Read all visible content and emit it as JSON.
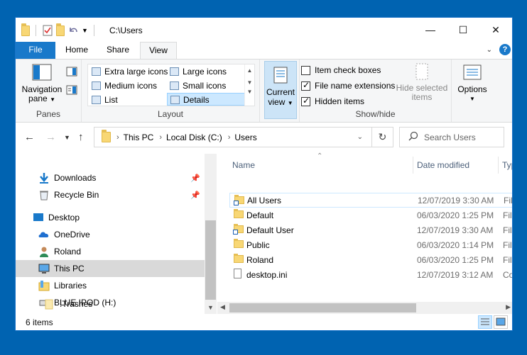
{
  "window": {
    "title": "C:\\Users"
  },
  "titlebar": {
    "minimize_glyph": "—",
    "maximize_glyph": "☐",
    "close_glyph": "✕"
  },
  "tabs": [
    {
      "label": "File"
    },
    {
      "label": "Home"
    },
    {
      "label": "Share"
    },
    {
      "label": "View"
    }
  ],
  "ribbon": {
    "panes": {
      "nav_pane_line1": "Navigation",
      "nav_pane_line2": "pane",
      "group_label": "Panes"
    },
    "layout": {
      "items": [
        {
          "label": "Extra large icons"
        },
        {
          "label": "Large icons"
        },
        {
          "label": "Medium icons"
        },
        {
          "label": "Small icons"
        },
        {
          "label": "List"
        },
        {
          "label": "Details"
        }
      ],
      "group_label": "Layout"
    },
    "current_view": {
      "line1": "Current",
      "line2": "view"
    },
    "show_hide": {
      "item_check_boxes": "Item check boxes",
      "file_name_extensions": "File name extensions",
      "hidden_items": "Hidden items",
      "hide_selected_line1": "Hide selected",
      "hide_selected_line2": "items",
      "group_label": "Show/hide"
    },
    "options": {
      "label": "Options"
    }
  },
  "address": {
    "crumbs": [
      "This PC",
      "Local Disk (C:)",
      "Users"
    ],
    "search_placeholder": "Search Users"
  },
  "navpane": {
    "items": [
      {
        "label": "Downloads"
      },
      {
        "label": "Recycle Bin"
      },
      {
        "label": "Desktop"
      },
      {
        "label": "OneDrive"
      },
      {
        "label": "Roland"
      },
      {
        "label": "This PC"
      },
      {
        "label": "Libraries"
      },
      {
        "label": "BLUE IPOD (H:)"
      },
      {
        "label": ".Trashes"
      }
    ]
  },
  "filelist": {
    "columns": {
      "name": "Name",
      "date": "Date modified",
      "type": "Typ"
    },
    "rows": [
      {
        "name": "All Users",
        "date": "12/07/2019 3:30 AM",
        "type": "File"
      },
      {
        "name": "Default",
        "date": "06/03/2020 1:25 PM",
        "type": "File"
      },
      {
        "name": "Default User",
        "date": "12/07/2019 3:30 AM",
        "type": "File"
      },
      {
        "name": "Public",
        "date": "06/03/2020 1:14 PM",
        "type": "File"
      },
      {
        "name": "Roland",
        "date": "06/03/2020 1:25 PM",
        "type": "File"
      },
      {
        "name": "desktop.ini",
        "date": "12/07/2019 3:12 AM",
        "type": "Co"
      }
    ]
  },
  "status": {
    "item_count": "6 items"
  }
}
